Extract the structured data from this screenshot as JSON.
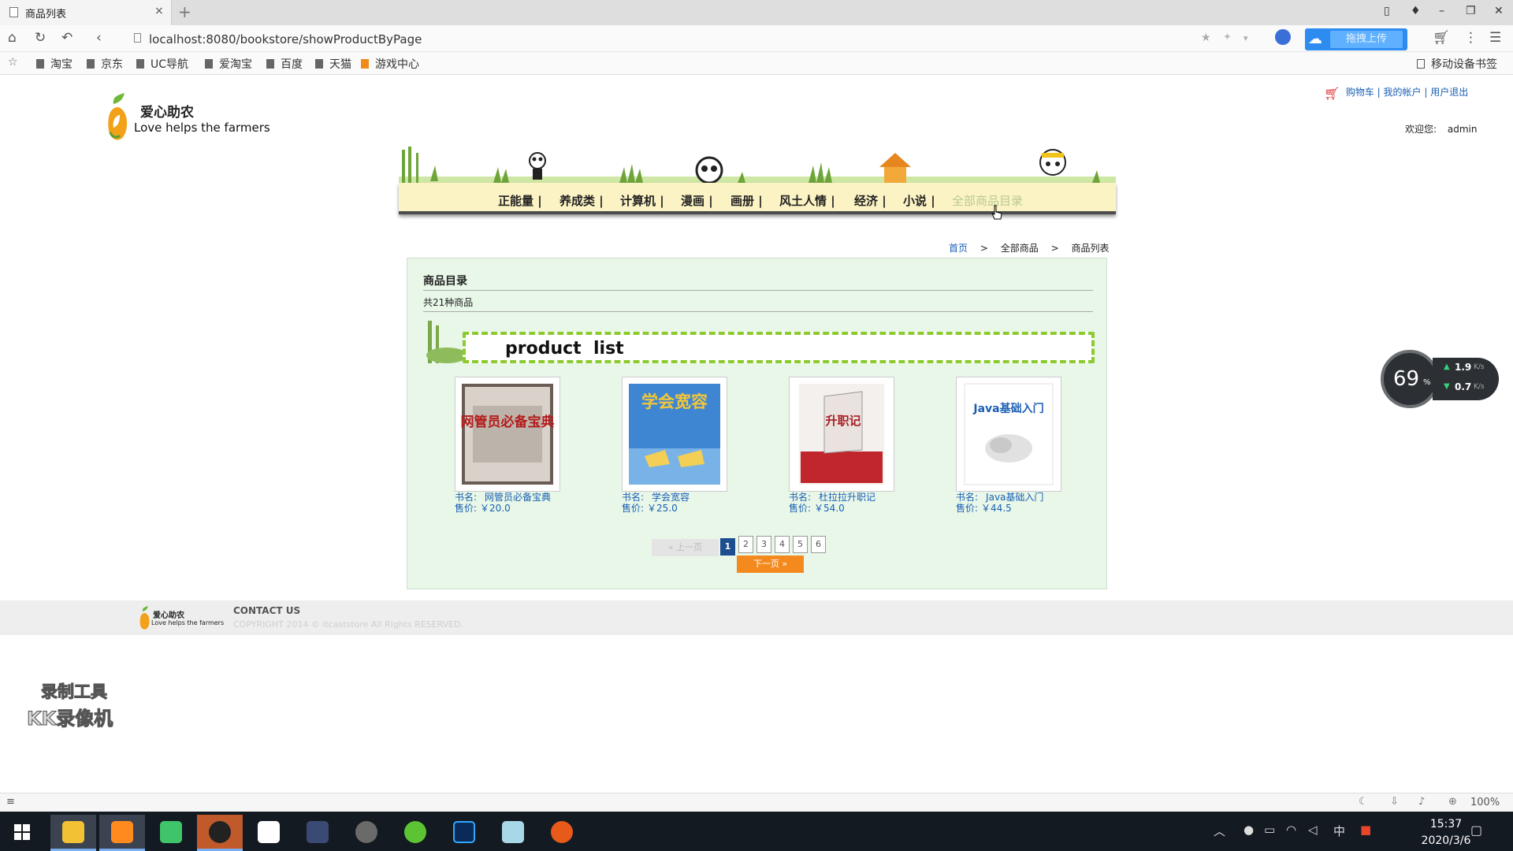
{
  "browser": {
    "tab_title": "商品列表",
    "tab_close": "×",
    "new_tab": "+",
    "url": "localhost:8080/bookstore/showProductByPage",
    "upload_label": "拖拽上传",
    "mobile_bookmarks": "移动设备书签",
    "bookmarks": [
      {
        "label": "淘宝"
      },
      {
        "label": "京东"
      },
      {
        "label": "UC导航"
      },
      {
        "label": "爱淘宝"
      },
      {
        "label": "百度"
      },
      {
        "label": "天猫"
      },
      {
        "label": "游戏中心"
      }
    ]
  },
  "site": {
    "logo_cn": "爱心助农",
    "logo_en": "Love helps the farmers",
    "top_links": {
      "cart": "购物车",
      "sep": " | ",
      "account": "我的帐户",
      "logout": "用户退出"
    },
    "welcome_label": "欢迎您:",
    "username": "admin",
    "nav": [
      "正能量 |",
      "养成类 |",
      "计算机 |",
      "漫画 |",
      "画册 |",
      "风土人情 |",
      "经济 |",
      "小说 |",
      "全部商品目录"
    ],
    "breadcrumb": {
      "home": "首页",
      "sep": ">",
      "all": "全部商品",
      "current": "商品列表"
    }
  },
  "catalog": {
    "title": "商品目录",
    "count": "共21种商品",
    "banner_text": "product  list",
    "products": [
      {
        "name_label": "书名:",
        "name": "网管员必备宝典",
        "price_label": "售价:",
        "price": "￥20.0",
        "cover_title": "网管员必备宝典"
      },
      {
        "name_label": "书名:",
        "name": "学会宽容",
        "price_label": "售价:",
        "price": "￥25.0",
        "cover_title": "学会宽容"
      },
      {
        "name_label": "书名:",
        "name": "杜拉拉升职记",
        "price_label": "售价:",
        "price": "￥54.0",
        "cover_title": "升职记"
      },
      {
        "name_label": "书名:",
        "name": "Java基础入门",
        "price_label": "售价:",
        "price": "￥44.5",
        "cover_title": "Java基础入门"
      }
    ],
    "pager": {
      "prev": "上一页",
      "pages": [
        "1",
        "2",
        "3",
        "4",
        "5",
        "6"
      ],
      "current": "1",
      "next": "下一页"
    }
  },
  "footer": {
    "logo_cn": "爱心助农",
    "logo_en": "Love helps the farmers",
    "contact": "CONTACT US",
    "copyright": "COPYRIGHT 2014 © itcaststore All Rights RESERVED."
  },
  "widgets": {
    "net_percent": "69",
    "net_percent_unit": "%",
    "upload_speed": "1.9",
    "download_speed": "0.7",
    "speed_unit": "K/s",
    "watermark_line1": "录制工具",
    "watermark_line2": "KK录像机"
  },
  "statusbar": {
    "zoom": "100%"
  },
  "taskbar": {
    "time": "15:37",
    "date": "2020/3/6",
    "ime": "中"
  },
  "colors": {
    "link": "#1a5fb4",
    "nav_bg": "#fbf3c4",
    "content_bg": "#e8f7e8",
    "pager_current": "#1d4f8f",
    "next_btn": "#f48a1e",
    "taskbar": "#141a22"
  }
}
